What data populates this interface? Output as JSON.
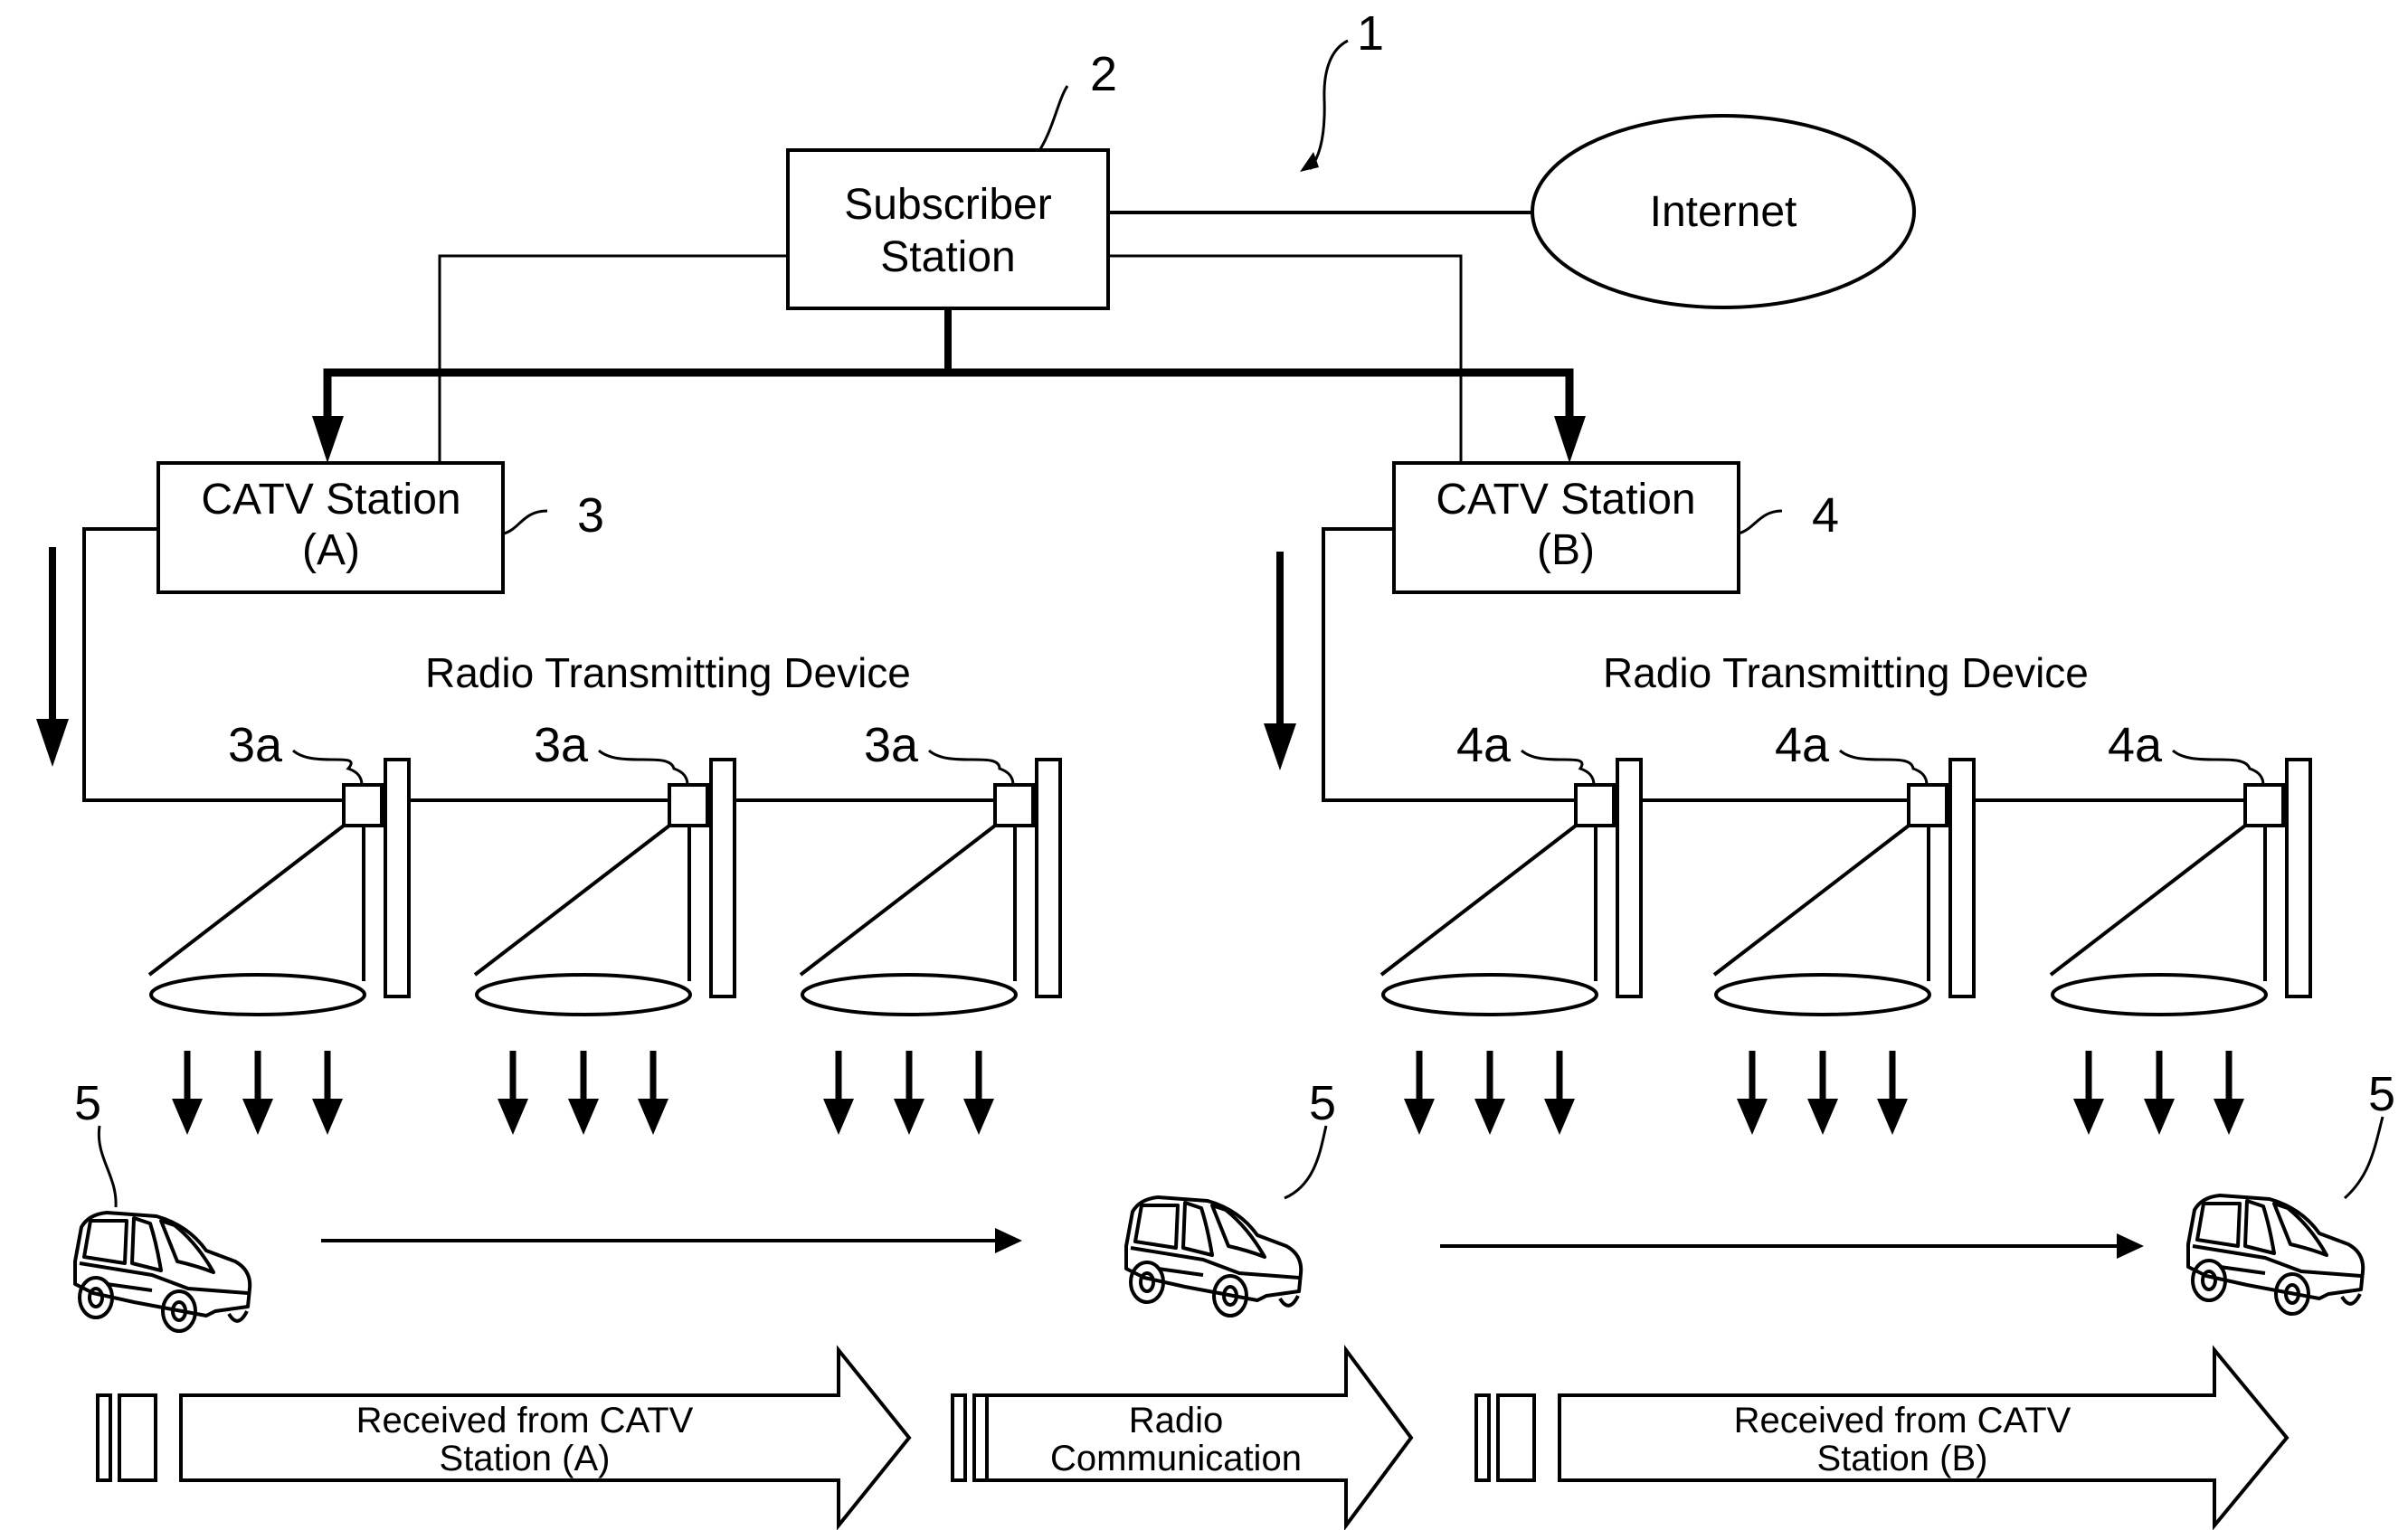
{
  "diagram": {
    "system_ref": "1",
    "subscriber_station": {
      "ref": "2",
      "lines": [
        "Subscriber",
        "Station"
      ]
    },
    "internet": {
      "label": "Internet"
    },
    "catv_a": {
      "ref": "3",
      "lines": [
        "CATV Station",
        "(A)"
      ],
      "device_label": "Radio Transmitting Device",
      "antenna_ref": "3a"
    },
    "catv_b": {
      "ref": "4",
      "lines": [
        "CATV Station",
        "(B)"
      ],
      "device_label": "Radio Transmitting Device",
      "antenna_ref": "4a"
    },
    "vehicle_ref": "5",
    "flow": [
      {
        "lines": [
          "Received from CATV",
          "Station (A)"
        ]
      },
      {
        "lines": [
          "Radio",
          "Communication"
        ]
      },
      {
        "lines": [
          "Received from CATV",
          "Station (B)"
        ]
      }
    ]
  },
  "colors": {
    "ink": "#000000",
    "background": "#ffffff"
  }
}
